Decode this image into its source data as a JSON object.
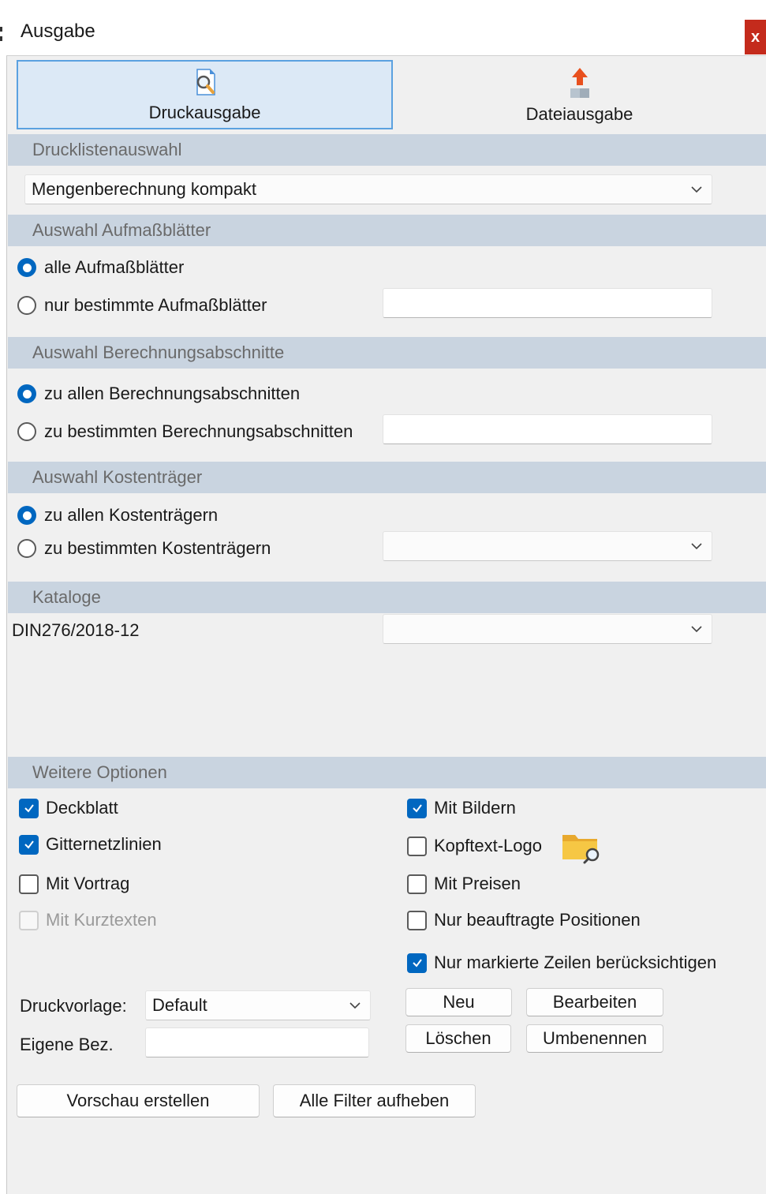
{
  "window": {
    "title": "Ausgabe",
    "close_label": "x"
  },
  "tabs": [
    {
      "label": "Druckausgabe",
      "icon": "print-preview-icon",
      "active": true
    },
    {
      "label": "Dateiausgabe",
      "icon": "file-export-icon",
      "active": false
    }
  ],
  "sections": {
    "drucklisten": "Drucklistenauswahl",
    "aufmass": "Auswahl Aufmaßblätter",
    "berechnung": "Auswahl Berechnungsabschnitte",
    "kostentraeger": "Auswahl Kostenträger",
    "kataloge": "Kataloge",
    "optionen": "Weitere Optionen"
  },
  "druckliste": {
    "selected": "Mengenberechnung kompakt"
  },
  "aufmass": {
    "options": [
      "alle Aufmaßblätter",
      "nur bestimmte Aufmaßblätter"
    ],
    "selected_index": 0,
    "value": ""
  },
  "berechnung": {
    "options": [
      "zu allen Berechnungsabschnitten",
      "zu bestimmten Berechnungsabschnitten"
    ],
    "selected_index": 0,
    "value": ""
  },
  "kostentraeger": {
    "options": [
      "zu allen Kostenträgern",
      "zu bestimmten Kostenträgern"
    ],
    "selected_index": 0,
    "selected": ""
  },
  "kataloge": {
    "name": "DIN276/2018-12",
    "selected": ""
  },
  "optionen": {
    "left": [
      {
        "label": "Deckblatt",
        "checked": true,
        "enabled": true
      },
      {
        "label": "Gitternetzlinien",
        "checked": true,
        "enabled": true
      },
      {
        "label": "Mit Vortrag",
        "checked": false,
        "enabled": true
      },
      {
        "label": "Mit Kurztexten",
        "checked": false,
        "enabled": false
      }
    ],
    "right": [
      {
        "label": "Mit Bildern",
        "checked": true
      },
      {
        "label": "Kopftext-Logo",
        "checked": false
      },
      {
        "label": "Mit Preisen",
        "checked": false
      },
      {
        "label": "Nur beauftragte Positionen",
        "checked": false
      },
      {
        "label": "Nur markierte Zeilen berücksichtigen",
        "checked": true
      }
    ]
  },
  "vorlage": {
    "druckvorlage_label": "Druckvorlage:",
    "druckvorlage_value": "Default",
    "eigene_label": "Eigene Bez.",
    "eigene_value": ""
  },
  "buttons": {
    "neu": "Neu",
    "bearbeiten": "Bearbeiten",
    "loeschen": "Löschen",
    "umbenennen": "Umbenennen",
    "vorschau": "Vorschau erstellen",
    "filter": "Alle Filter aufheben"
  },
  "colors": {
    "accent": "#0067c0",
    "section_bg": "#c9d4e0",
    "tab_active_bg": "#dce9f6",
    "close_bg": "#c42b1c"
  }
}
